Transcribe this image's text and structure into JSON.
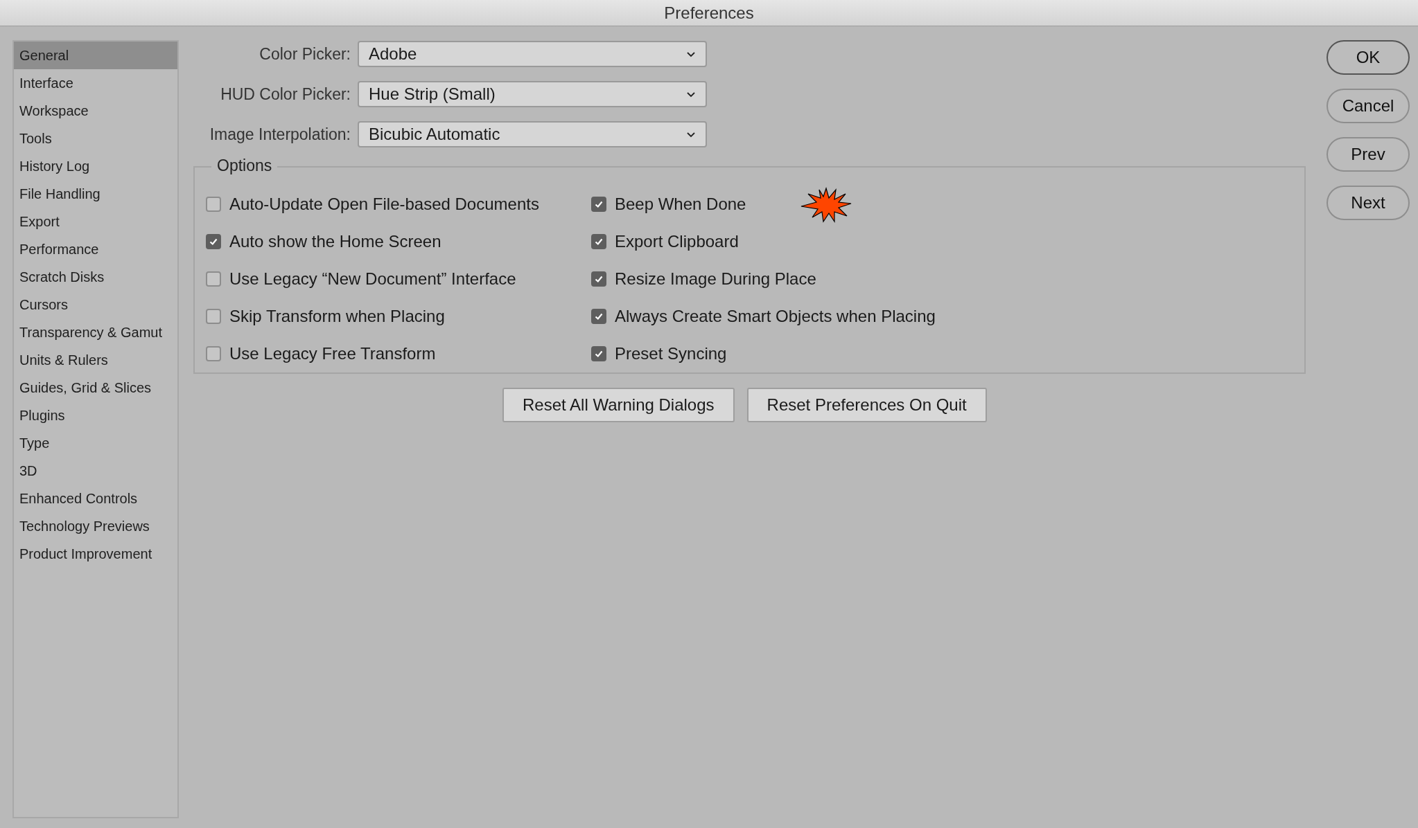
{
  "window": {
    "title": "Preferences"
  },
  "sidebar": {
    "items": [
      {
        "label": "General",
        "selected": true
      },
      {
        "label": "Interface",
        "selected": false
      },
      {
        "label": "Workspace",
        "selected": false
      },
      {
        "label": "Tools",
        "selected": false
      },
      {
        "label": "History Log",
        "selected": false
      },
      {
        "label": "File Handling",
        "selected": false
      },
      {
        "label": "Export",
        "selected": false
      },
      {
        "label": "Performance",
        "selected": false
      },
      {
        "label": "Scratch Disks",
        "selected": false
      },
      {
        "label": "Cursors",
        "selected": false
      },
      {
        "label": "Transparency & Gamut",
        "selected": false
      },
      {
        "label": "Units & Rulers",
        "selected": false
      },
      {
        "label": "Guides, Grid & Slices",
        "selected": false
      },
      {
        "label": "Plugins",
        "selected": false
      },
      {
        "label": "Type",
        "selected": false
      },
      {
        "label": "3D",
        "selected": false
      },
      {
        "label": "Enhanced Controls",
        "selected": false
      },
      {
        "label": "Technology Previews",
        "selected": false
      },
      {
        "label": "Product Improvement",
        "selected": false
      }
    ]
  },
  "dropdowns": [
    {
      "label": "Color Picker:",
      "value": "Adobe"
    },
    {
      "label": "HUD Color Picker:",
      "value": "Hue Strip (Small)"
    },
    {
      "label": "Image Interpolation:",
      "value": "Bicubic Automatic"
    }
  ],
  "options": {
    "title": "Options",
    "columns": [
      [
        {
          "label": "Auto-Update Open File-based Documents",
          "checked": false
        },
        {
          "label": "Auto show the Home Screen",
          "checked": true
        },
        {
          "label": "Use Legacy “New Document” Interface",
          "checked": false
        },
        {
          "label": "Skip Transform when Placing",
          "checked": false
        },
        {
          "label": "Use Legacy Free Transform",
          "checked": false
        }
      ],
      [
        {
          "label": "Beep When Done",
          "checked": true
        },
        {
          "label": "Export Clipboard",
          "checked": true
        },
        {
          "label": "Resize Image During Place",
          "checked": true
        },
        {
          "label": "Always Create Smart Objects when Placing",
          "checked": true
        },
        {
          "label": "Preset Syncing",
          "checked": true
        }
      ]
    ]
  },
  "reset_buttons": [
    "Reset All Warning Dialogs",
    "Reset Preferences On Quit"
  ],
  "dialog_buttons": [
    {
      "label": "OK",
      "default": true
    },
    {
      "label": "Cancel",
      "default": false
    },
    {
      "label": "Prev",
      "default": false
    },
    {
      "label": "Next",
      "default": false
    }
  ]
}
